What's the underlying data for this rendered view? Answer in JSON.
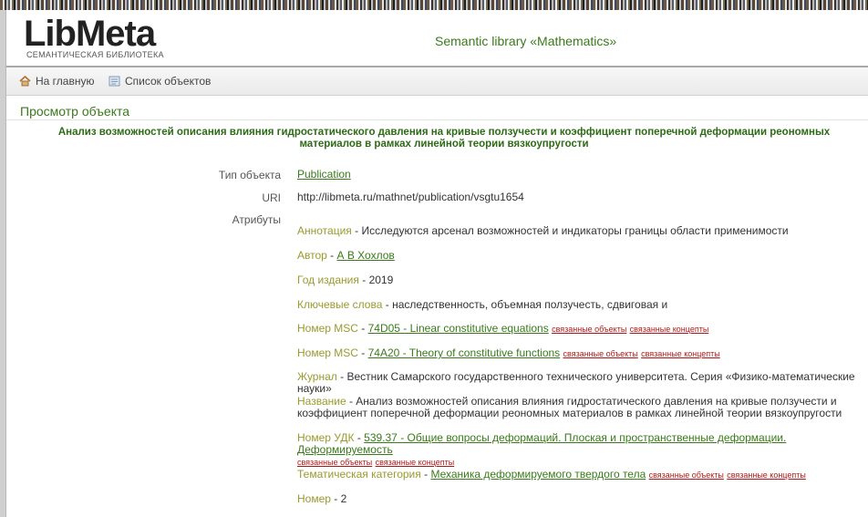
{
  "header": {
    "logo_main": "LibMeta",
    "logo_sub": "СЕМАНТИЧЕСКАЯ БИБЛИОТЕКА",
    "site_title": "Semantic library «Mathematics»"
  },
  "nav": {
    "home": "На главную",
    "objects": "Список объектов"
  },
  "page": {
    "heading": "Просмотр объекта",
    "object_title": "Анализ возможностей описания влияния гидростатического давления на кривые ползучести и коэффициент поперечной деформации реономных материалов в рамках линейной теории вязкоупругости"
  },
  "fields": {
    "type_label": "Тип объекта",
    "type_value": "Publication",
    "uri_label": "URI",
    "uri_value": "http://libmeta.ru/mathnet/publication/vsgtu1654",
    "attrs_label": "Атрибуты"
  },
  "attributes": [
    {
      "key": "Аннотация",
      "value": "Исследуются арсенал возможностей и индикаторы границы области применимости"
    },
    {
      "key": "Автор",
      "link": "А В Хохлов"
    },
    {
      "key": "Год издания",
      "value": "2019"
    },
    {
      "key": "Ключевые слова",
      "value": "наследственность, объемная ползучесть, сдвиговая и"
    },
    {
      "key": "Номер MSC",
      "link": "74D05 - Linear constitutive equations",
      "rel1": "связанные объекты",
      "rel2": "связанные концепты"
    },
    {
      "key": "Номер MSC",
      "link": "74A20 - Theory of constitutive functions",
      "rel1": "связанные объекты",
      "rel2": "связанные концепты"
    },
    {
      "key": "Журнал",
      "value": "Вестник Самарского государственного технического университета. Серия «Физико-математические науки»"
    },
    {
      "key": "Название",
      "value": "Анализ возможностей описания влияния гидростатического давления на кривые ползучести и",
      "value2": "коэффициент поперечной деформации реономных материалов в рамках линейной теории вязкоупругости"
    },
    {
      "key": "Номер УДК",
      "link": "539.37 - Общие вопросы деформаций. Плоская и пространственные деформации. Деформируемость",
      "rel1": "связанные объекты",
      "rel2": "связанные концепты"
    },
    {
      "key": "Тематическая категория",
      "link": "Механика деформируемого твердого тела",
      "rel1": "связанные объекты",
      "rel2": "связанные концепты"
    },
    {
      "key": "Номер",
      "value": "2"
    }
  ],
  "separator": " - "
}
